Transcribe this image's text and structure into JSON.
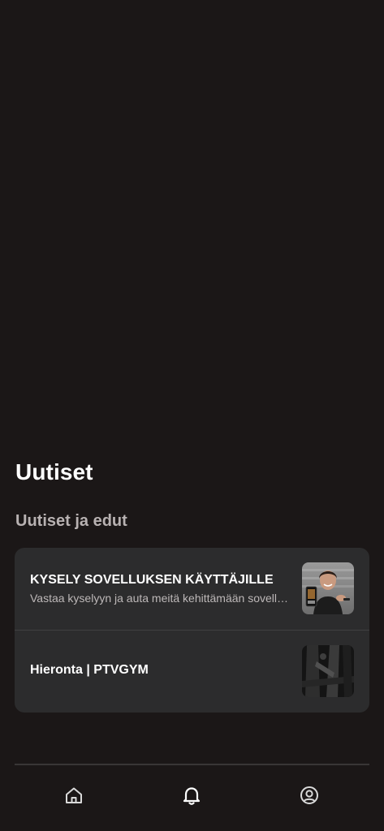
{
  "header": {
    "title": "Uutiset"
  },
  "section": {
    "title": "Uutiset ja edut"
  },
  "news": [
    {
      "title": "KYSELY SOVELLUKSEN KÄYTTÄJILLE",
      "subtitle": "Vastaa kyselyyn ja auta meitä kehittämään sovelluksta"
    },
    {
      "title": "Hieronta | PTVGYM"
    }
  ],
  "bottom_nav": {
    "items": [
      {
        "icon": "home-icon"
      },
      {
        "icon": "bell-icon",
        "active": true
      },
      {
        "icon": "profile-icon"
      }
    ]
  },
  "colors": {
    "background": "#1b1717",
    "card": "#2c2c2d",
    "section_title": "#b8b2b2",
    "subtitle": "#bdb8b8"
  }
}
